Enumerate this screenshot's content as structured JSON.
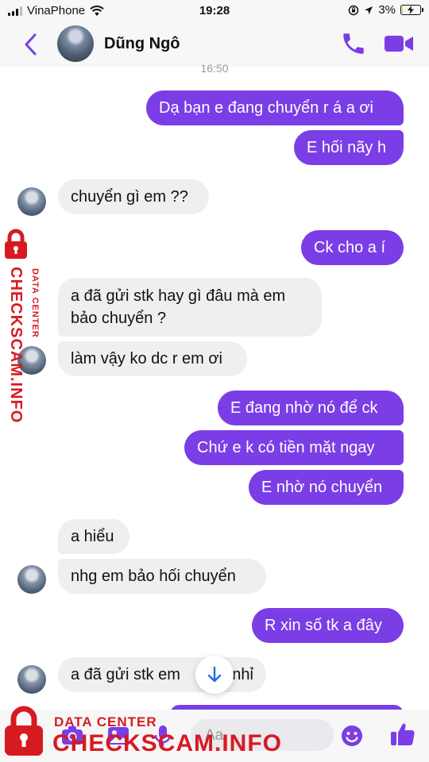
{
  "status_bar": {
    "carrier": "VinaPhone",
    "time": "19:28",
    "battery": "3%",
    "battery_level": 0.03
  },
  "header": {
    "contact_name": "Dũng Ngô",
    "icons": [
      "back-chevron-icon",
      "phone-icon",
      "video-call-icon"
    ],
    "accent_color": "#7b3de6"
  },
  "chat": {
    "timestamp": "16:50",
    "messages": [
      {
        "dir": "out",
        "text": "Dạ bạn e đang chuyển r á a ơi"
      },
      {
        "dir": "out",
        "text": "E hối nãy h"
      },
      {
        "dir": "in",
        "text": "chuyển gì em ??"
      },
      {
        "dir": "out",
        "text": "Ck cho a í"
      },
      {
        "dir": "in",
        "text": "a đã gửi stk hay gì đâu mà em"
      },
      {
        "dir": "in",
        "text": "bảo chuyển ?"
      },
      {
        "dir": "in",
        "text": "làm vậy ko dc r em ơi"
      },
      {
        "dir": "out",
        "text": "E đang nhờ nó để ck"
      },
      {
        "dir": "out",
        "text": "Chứ e k có tiền mặt ngay"
      },
      {
        "dir": "out",
        "text": "E nhờ nó chuyển"
      },
      {
        "dir": "in",
        "text": "a hiểu"
      },
      {
        "dir": "in",
        "text": "nhg em bảo hối chuyển"
      },
      {
        "dir": "out",
        "text": "R xin số tk a đây"
      },
      {
        "dir": "in",
        "text": "a đã gửi stk em"
      },
      {
        "dir": "in",
        "text": "nhỉ"
      }
    ],
    "outgoing_color": "#7b3de6",
    "incoming_color": "#efefef"
  },
  "composer": {
    "placeholder": "Aa",
    "icons": [
      "camera-icon",
      "photo-icon",
      "microphone-icon",
      "emoji-icon",
      "thumbs-up-icon"
    ]
  },
  "watermark": {
    "line1": "DATA CENTER",
    "line2": "CHECKSCAM.INFO",
    "color": "#d71a21"
  }
}
